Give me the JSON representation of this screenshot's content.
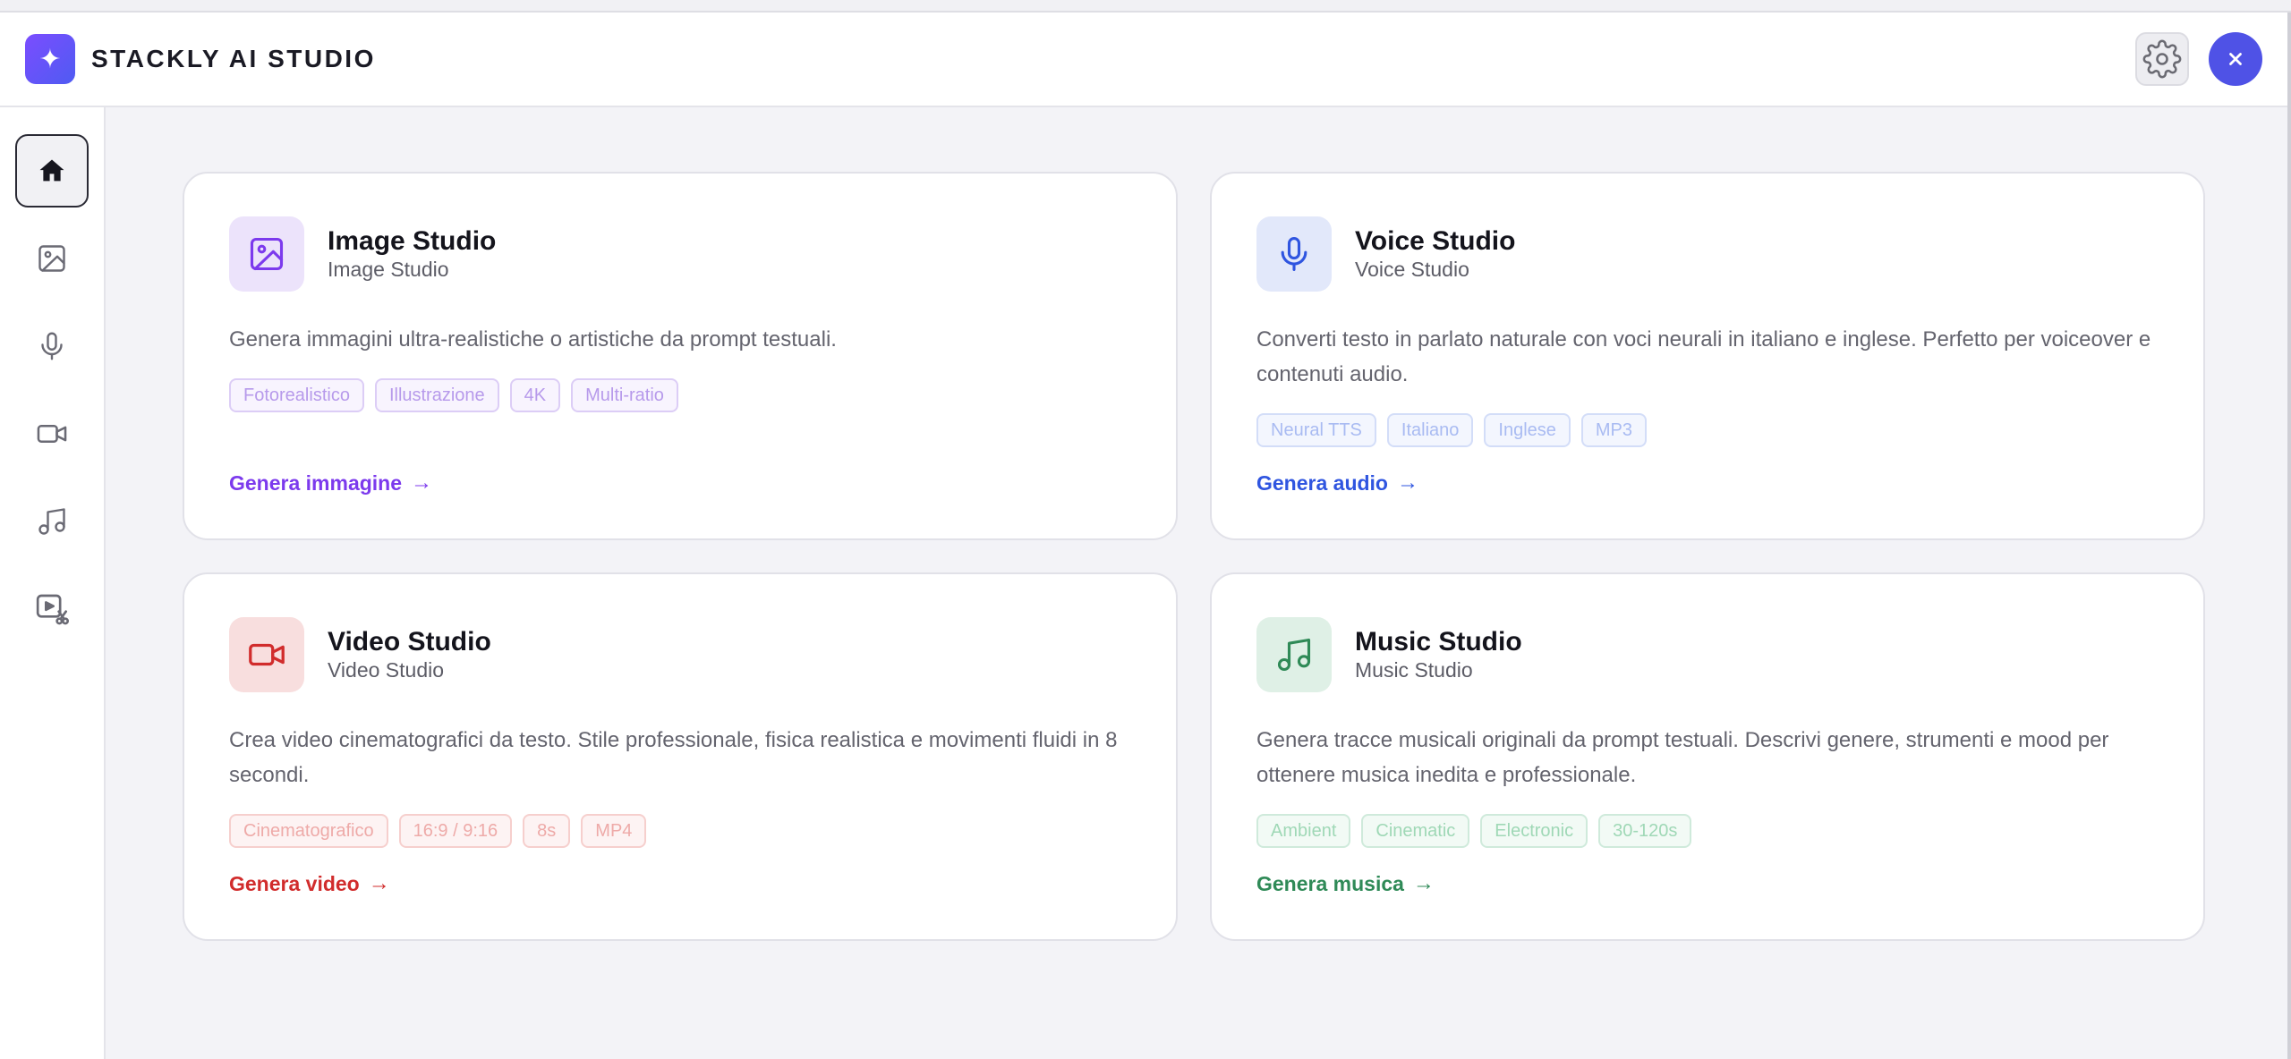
{
  "app": {
    "title": "STACKLY AI STUDIO",
    "logo_icon": "sparkle-icon",
    "accent": "#4f52e6"
  },
  "header": {
    "settings_icon": "gear-icon",
    "close_icon": "close-icon"
  },
  "sidebar": {
    "items": [
      {
        "icon": "home-icon",
        "active": true
      },
      {
        "icon": "image-icon",
        "active": false
      },
      {
        "icon": "microphone-icon",
        "active": false
      },
      {
        "icon": "video-camera-icon",
        "active": false
      },
      {
        "icon": "music-note-icon",
        "active": false
      },
      {
        "icon": "video-edit-icon",
        "active": false
      }
    ]
  },
  "cards": [
    {
      "title": "Image Studio",
      "subtitle": "Image Studio",
      "description": "Genera immagini ultra-realistiche o artistiche da prompt testuali.",
      "tags": [
        "Fotorealistico",
        "Illustrazione",
        "4K",
        "Multi-ratio"
      ],
      "cta": "Genera immagine",
      "icon": "image-icon",
      "color": "#7c3aed",
      "icon_bg": "#ece3fb"
    },
    {
      "title": "Voice Studio",
      "subtitle": "Voice Studio",
      "description": "Converti testo in parlato naturale con voci neurali in italiano e inglese. Perfetto per voiceover e contenuti audio.",
      "tags": [
        "Neural TTS",
        "Italiano",
        "Inglese",
        "MP3"
      ],
      "cta": "Genera audio",
      "icon": "microphone-icon",
      "color": "#2f55e0",
      "icon_bg": "#e2e8fa"
    },
    {
      "title": "Video Studio",
      "subtitle": "Video Studio",
      "description": "Crea video cinematografici da testo. Stile professionale, fisica realistica e movimenti fluidi in 8 secondi.",
      "tags": [
        "Cinematografico",
        "16:9 / 9:16",
        "8s",
        "MP4"
      ],
      "cta": "Genera video",
      "icon": "video-camera-icon",
      "color": "#d12c2c",
      "icon_bg": "#f8dede"
    },
    {
      "title": "Music Studio",
      "subtitle": "Music Studio",
      "description": "Genera tracce musicali originali da prompt testuali. Descrivi genere, strumenti e mood per ottenere musica inedita e professionale.",
      "tags": [
        "Ambient",
        "Cinematic",
        "Electronic",
        "30-120s"
      ],
      "cta": "Genera musica",
      "icon": "music-note-icon",
      "color": "#2f8a57",
      "icon_bg": "#dff0e6"
    }
  ]
}
